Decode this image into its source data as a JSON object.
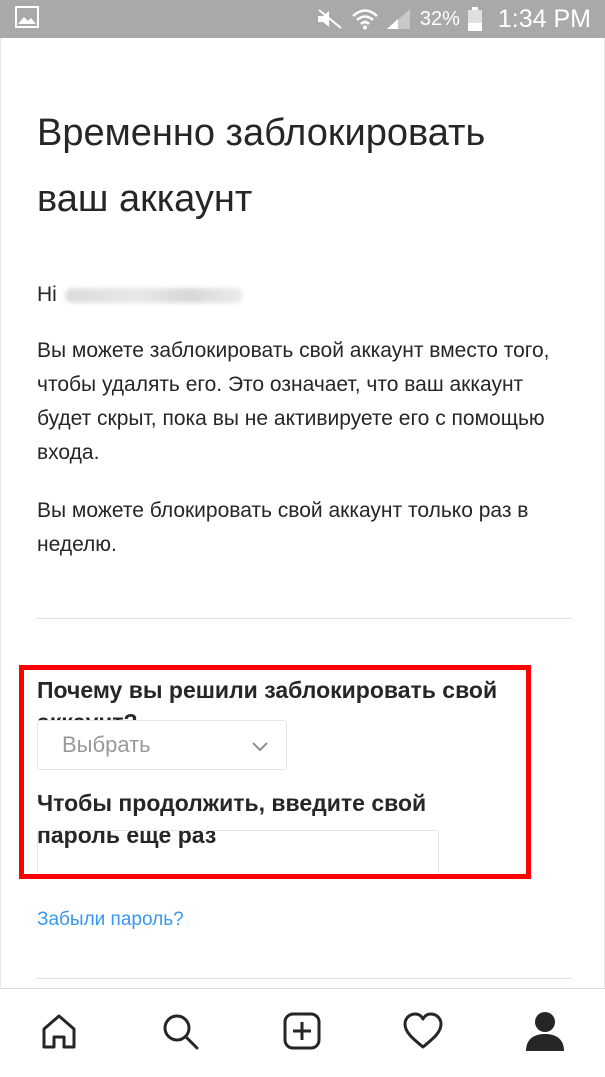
{
  "status_bar": {
    "battery": "32%",
    "time": "1:34 PM",
    "icons": [
      "gallery-icon",
      "mute-icon",
      "wifi-icon",
      "signal-icon",
      "battery-icon"
    ]
  },
  "page": {
    "title": "Временно заблокировать ваш аккаунт",
    "greeting": "Hi",
    "paragraph1": "Вы можете заблокировать свой аккаунт вместо того, чтобы удалять его. Это означает, что ваш аккаунт будет скрыт, пока вы не активируете его с помощью входа.",
    "paragraph2": "Вы можете блокировать свой аккаунт только раз в неделю."
  },
  "form": {
    "reason_label": "Почему вы решили заблокировать свой аккаунт?",
    "reason_select_value": "Выбрать",
    "password_label": "Чтобы продолжить, введите свой пароль еще раз",
    "password_value": "",
    "forgot_password": "Забыли пароль?"
  },
  "bottom_nav": {
    "items": [
      "home-icon",
      "search-icon",
      "add-post-icon",
      "activity-heart-icon",
      "profile-icon"
    ]
  },
  "colors": {
    "link": "#3897f0",
    "highlight": "#ff0000",
    "status_bar": "#a9a9a9",
    "text": "#262626"
  }
}
